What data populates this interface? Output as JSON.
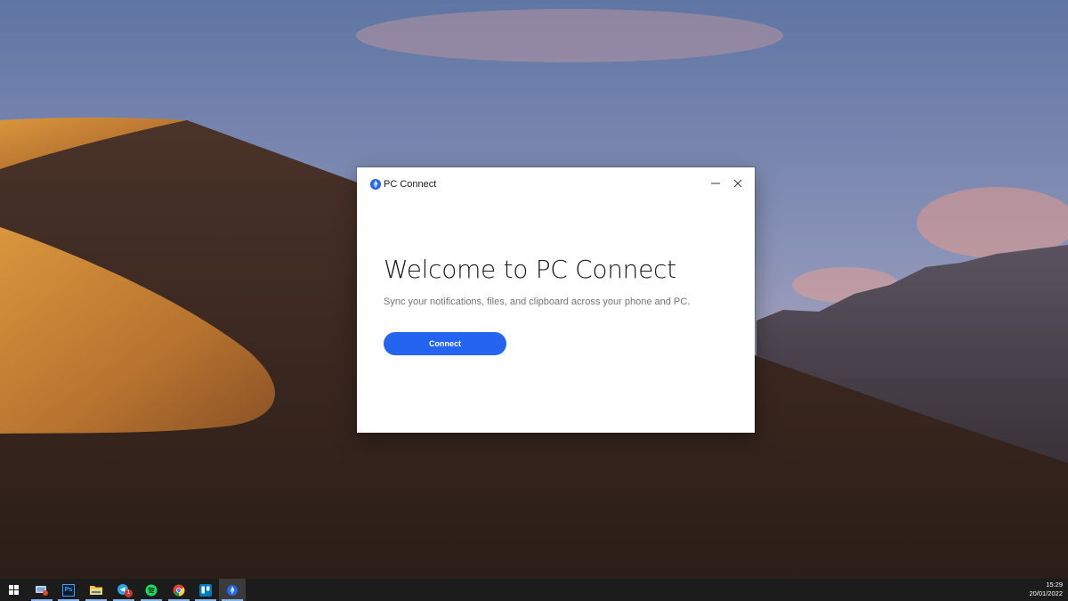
{
  "window": {
    "title": "PC Connect",
    "heading": "Welcome to PC Connect",
    "subtitle": "Sync your notifications, files, and clipboard across your phone and PC.",
    "connect_label": "Connect",
    "accent_color": "#2563f1"
  },
  "taskbar": {
    "items": [
      {
        "name": "start-icon"
      },
      {
        "name": "remote-desktop-icon"
      },
      {
        "name": "photoshop-icon",
        "label": "Ps"
      },
      {
        "name": "file-explorer-icon"
      },
      {
        "name": "telegram-icon",
        "badge": "1"
      },
      {
        "name": "spotify-icon"
      },
      {
        "name": "chrome-icon"
      },
      {
        "name": "trello-icon"
      },
      {
        "name": "pc-connect-icon"
      }
    ],
    "time": "15:29",
    "date": "20/01/2022"
  }
}
